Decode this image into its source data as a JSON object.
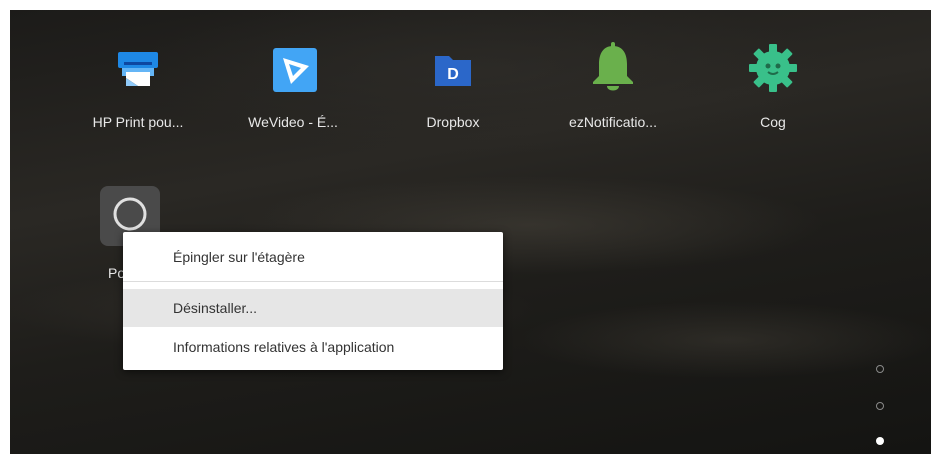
{
  "apps": [
    {
      "label": "HP Print pou...",
      "icon": "printer-icon",
      "color": "#2196f3"
    },
    {
      "label": "WeVideo - É...",
      "icon": "wevideo-icon",
      "color": "#3a9be0"
    },
    {
      "label": "Dropbox",
      "icon": "dropbox-icon",
      "color": "#2b67c9"
    },
    {
      "label": "ezNotificatio...",
      "icon": "bell-icon",
      "color": "#6ab04c"
    },
    {
      "label": "Cog",
      "icon": "cog-icon",
      "color": "#39c08a"
    }
  ],
  "partial_app": {
    "label": "Po",
    "icon": "circle-icon"
  },
  "context_menu": {
    "items": [
      {
        "label": "Épingler sur l'étagère"
      },
      {
        "label": "Désinstaller..."
      },
      {
        "label": "Informations relatives à l'application"
      }
    ],
    "hovered_index": 1
  },
  "page_indicator": {
    "pages": 3,
    "current": 3
  }
}
